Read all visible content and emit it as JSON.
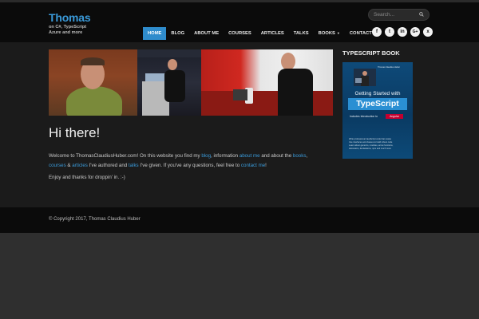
{
  "site": {
    "logo_title": "Thomas",
    "logo_subtitle": "on C#, TypeScript\nAzure and more"
  },
  "search": {
    "placeholder": "Search..."
  },
  "nav": {
    "items": [
      {
        "label": "HOME",
        "active": true
      },
      {
        "label": "BLOG"
      },
      {
        "label": "ABOUT ME"
      },
      {
        "label": "COURSES"
      },
      {
        "label": "ARTICLES"
      },
      {
        "label": "TALKS"
      },
      {
        "label": "BOOKS",
        "has_dropdown": true
      },
      {
        "label": "CONTACT"
      }
    ]
  },
  "social": {
    "icons": [
      "facebook-icon",
      "twitter-icon",
      "linkedin-icon",
      "google-plus-icon",
      "xing-icon"
    ],
    "glyphs": [
      "f",
      "t",
      "in",
      "G+",
      "x"
    ]
  },
  "main": {
    "heading": "Hi there!",
    "welcome": {
      "t1": "Welcome to ThomasClaudiusHuber.com! On this website you find my ",
      "blog": "blog",
      "t2": ", information ",
      "about": "about me",
      "t3": " and about the ",
      "books": "books",
      "t4": ",",
      "courses": "courses",
      "t5": " & ",
      "articles": "articles",
      "t6": " I've authored and ",
      "talks": "talks",
      "t7": " I've given. If you've any questions, feel free to ",
      "contact": "contact me",
      "t8": "!"
    },
    "enjoy": "Enjoy and thanks for droppin' in. :-)"
  },
  "sidebar": {
    "title": "TYPESCRIPT BOOK",
    "book": {
      "author": "Thomas Claudius Huber",
      "getting": "Getting Started with",
      "ts": "TypeScript",
      "incl": "Includes Introduction to",
      "ng": "Angular",
      "lines": [
        "Write professional JavaScript code that scales",
        "Use interfaces and classes to build robust code",
        "Learn about generics, modules, arrow functions,",
        "decorators, declarations, npm and much more"
      ]
    }
  },
  "footer": {
    "copyright": "© Copyright 2017, Thomas Claudius Huber"
  },
  "colors": {
    "accent": "#2f8ccc",
    "link": "#3a9ad9",
    "header_bg": "#0b0b0b",
    "main_bg": "#1b1b1b",
    "page_bg": "#2f2f2f"
  }
}
